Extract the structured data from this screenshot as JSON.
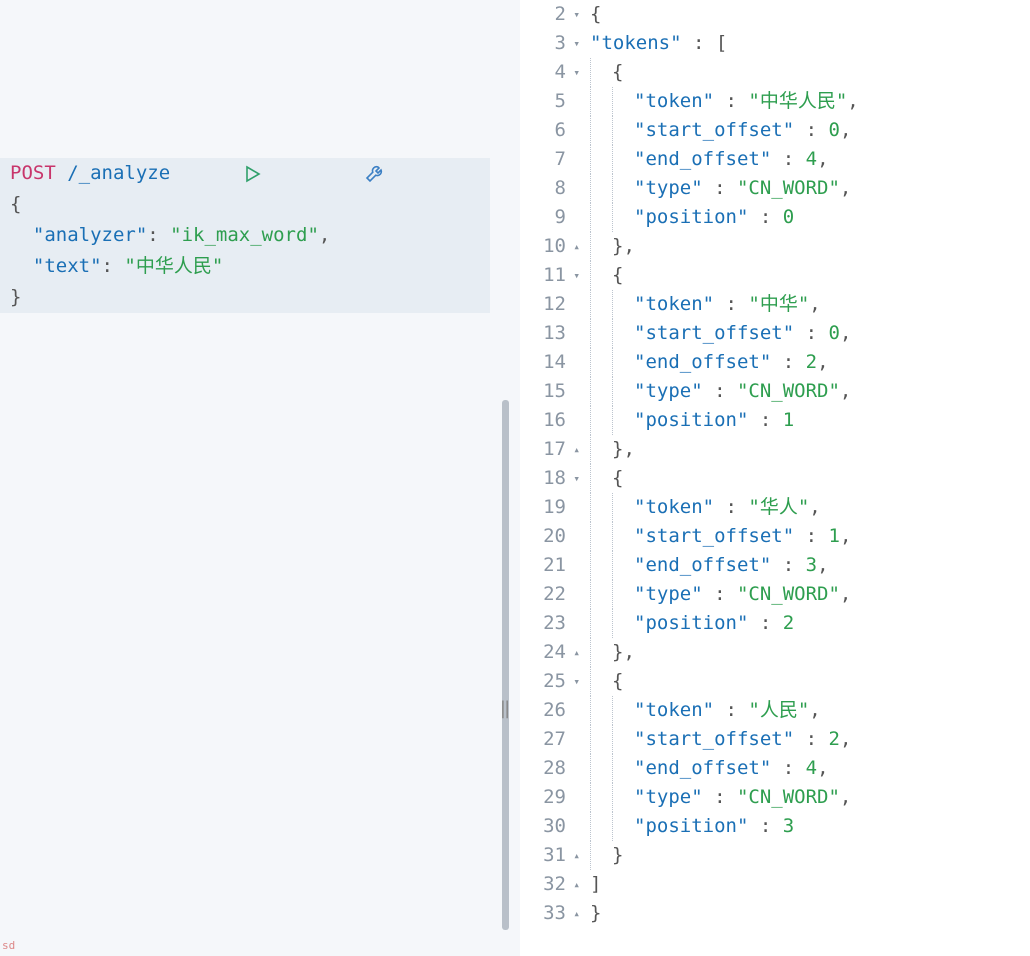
{
  "request": {
    "method": "POST",
    "path": "/_analyze",
    "body": {
      "open": "{",
      "analyzer_key": "\"analyzer\"",
      "analyzer_val": "\"ik_max_word\"",
      "text_key": "\"text\"",
      "text_val": "\"中华人民\"",
      "close": "}"
    }
  },
  "response": {
    "gutter": [
      "2",
      "3",
      "4",
      "5",
      "6",
      "7",
      "8",
      "9",
      "10",
      "11",
      "12",
      "13",
      "14",
      "15",
      "16",
      "17",
      "18",
      "19",
      "20",
      "21",
      "22",
      "23",
      "24",
      "25",
      "26",
      "27",
      "28",
      "29",
      "30",
      "31",
      "32",
      "33"
    ],
    "lines": {
      "l2": "{",
      "l3_key": "\"tokens\"",
      "l3_tail": " : [",
      "l4": "{",
      "l5k": "\"token\"",
      "l5v": "\"中华人民\"",
      "l6k": "\"start_offset\"",
      "l6v": "0",
      "l7k": "\"end_offset\"",
      "l7v": "4",
      "l8k": "\"type\"",
      "l8v": "\"CN_WORD\"",
      "l9k": "\"position\"",
      "l9v": "0",
      "l10": "},",
      "l11": "{",
      "l12k": "\"token\"",
      "l12v": "\"中华\"",
      "l13k": "\"start_offset\"",
      "l13v": "0",
      "l14k": "\"end_offset\"",
      "l14v": "2",
      "l15k": "\"type\"",
      "l15v": "\"CN_WORD\"",
      "l16k": "\"position\"",
      "l16v": "1",
      "l17": "},",
      "l18": "{",
      "l19k": "\"token\"",
      "l19v": "\"华人\"",
      "l20k": "\"start_offset\"",
      "l20v": "1",
      "l21k": "\"end_offset\"",
      "l21v": "3",
      "l22k": "\"type\"",
      "l22v": "\"CN_WORD\"",
      "l23k": "\"position\"",
      "l23v": "2",
      "l24": "},",
      "l25": "{",
      "l26k": "\"token\"",
      "l26v": "\"人民\"",
      "l27k": "\"start_offset\"",
      "l27v": "2",
      "l28k": "\"end_offset\"",
      "l28v": "4",
      "l29k": "\"type\"",
      "l29v": "\"CN_WORD\"",
      "l30k": "\"position\"",
      "l30v": "3",
      "l31": "}",
      "l32": "]",
      "l33": "}"
    }
  },
  "footer": {
    "sd": "sd"
  }
}
